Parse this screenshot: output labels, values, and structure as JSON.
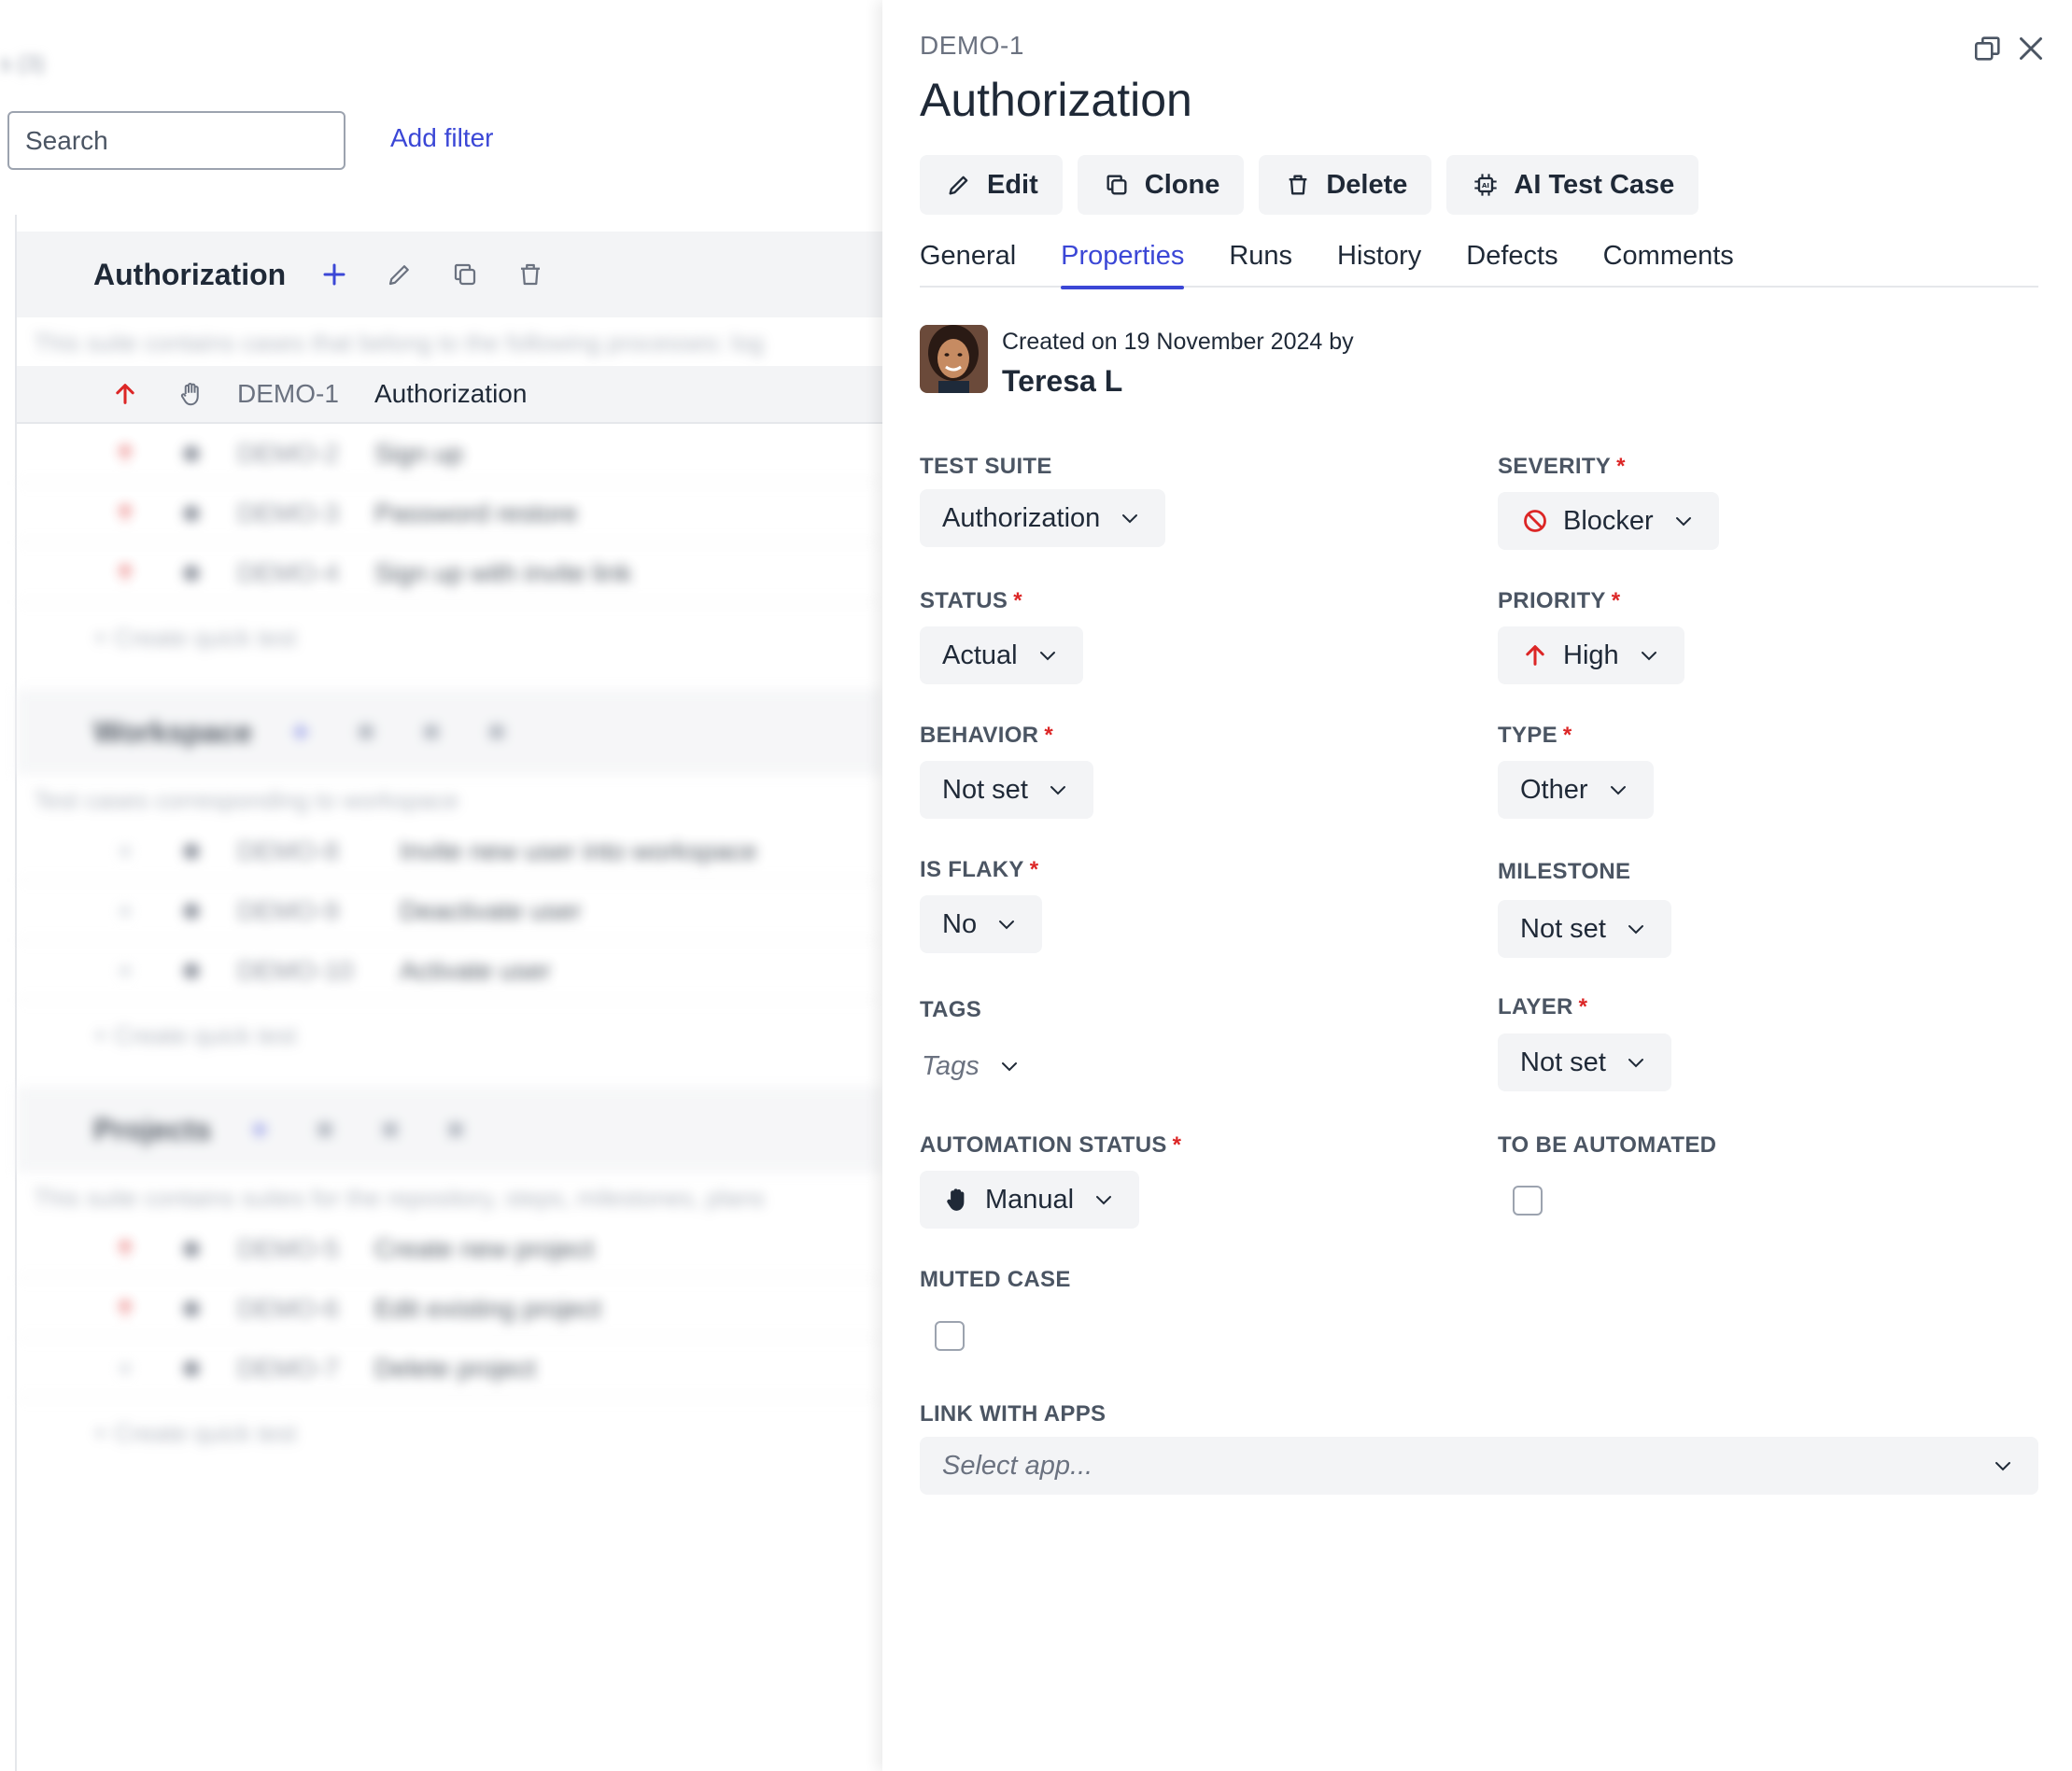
{
  "left": {
    "ghost_top": "s (3)",
    "search_placeholder": "Search",
    "add_filter": "Add filter",
    "suites": [
      {
        "title": "Authorization",
        "description": "This suite contains cases that belong to the following processes: log",
        "rows": [
          {
            "id": "DEMO-1",
            "title": "Authorization",
            "priority": "high"
          },
          {
            "id": "DEMO-2",
            "title": "Sign up",
            "priority": "high"
          },
          {
            "id": "DEMO-3",
            "title": "Password restore",
            "priority": "high"
          },
          {
            "id": "DEMO-4",
            "title": "Sign up with invite link",
            "priority": "high"
          }
        ],
        "quick": "+ Create quick test"
      },
      {
        "title": "Workspace",
        "description": "Test cases corresponding to workspace",
        "rows": [
          {
            "id": "DEMO-8",
            "title": "Invite new user into workspace",
            "priority": "medium"
          },
          {
            "id": "DEMO-9",
            "title": "Deactivate user",
            "priority": "medium"
          },
          {
            "id": "DEMO-10",
            "title": "Activate user",
            "priority": "medium"
          }
        ],
        "quick": "+ Create quick test"
      },
      {
        "title": "Projects",
        "description": "This suite contains suites for the repository, steps, milestones, plans",
        "rows": [
          {
            "id": "DEMO-5",
            "title": "Create new project",
            "priority": "high"
          },
          {
            "id": "DEMO-6",
            "title": "Edit existing project",
            "priority": "high"
          },
          {
            "id": "DEMO-7",
            "title": "Delete project",
            "priority": "medium"
          }
        ],
        "quick": "+ Create quick test"
      }
    ]
  },
  "panel": {
    "key": "DEMO-1",
    "title": "Authorization",
    "toolbar": {
      "edit": "Edit",
      "clone": "Clone",
      "delete": "Delete",
      "ai": "AI Test Case"
    },
    "tabs": [
      "General",
      "Properties",
      "Runs",
      "History",
      "Defects",
      "Comments"
    ],
    "active_tab": "Properties",
    "created_text": "Created on 19 November 2024 by",
    "author": "Teresa L",
    "fields": {
      "test_suite": {
        "label": "TEST SUITE",
        "value": "Authorization"
      },
      "severity": {
        "label": "SEVERITY",
        "value": "Blocker"
      },
      "status": {
        "label": "STATUS",
        "value": "Actual"
      },
      "priority": {
        "label": "PRIORITY",
        "value": "High"
      },
      "behavior": {
        "label": "BEHAVIOR",
        "value": "Not set"
      },
      "type": {
        "label": "TYPE",
        "value": "Other"
      },
      "is_flaky": {
        "label": "IS FLAKY",
        "value": "No"
      },
      "milestone": {
        "label": "MILESTONE",
        "value": "Not set"
      },
      "tags": {
        "label": "TAGS",
        "placeholder": "Tags"
      },
      "layer": {
        "label": "LAYER",
        "value": "Not set"
      },
      "automation_status": {
        "label": "AUTOMATION STATUS",
        "value": "Manual"
      },
      "to_be_automated": {
        "label": "TO BE AUTOMATED",
        "checked": false
      },
      "muted_case": {
        "label": "MUTED CASE",
        "checked": false
      },
      "link_with_apps": {
        "label": "LINK WITH APPS",
        "placeholder": "Select app..."
      }
    },
    "required_mark": "*"
  },
  "colors": {
    "accent": "#3b47d6",
    "required": "#dc2626",
    "priority_high": "#dc2626",
    "field_bg": "#f3f4f6"
  }
}
